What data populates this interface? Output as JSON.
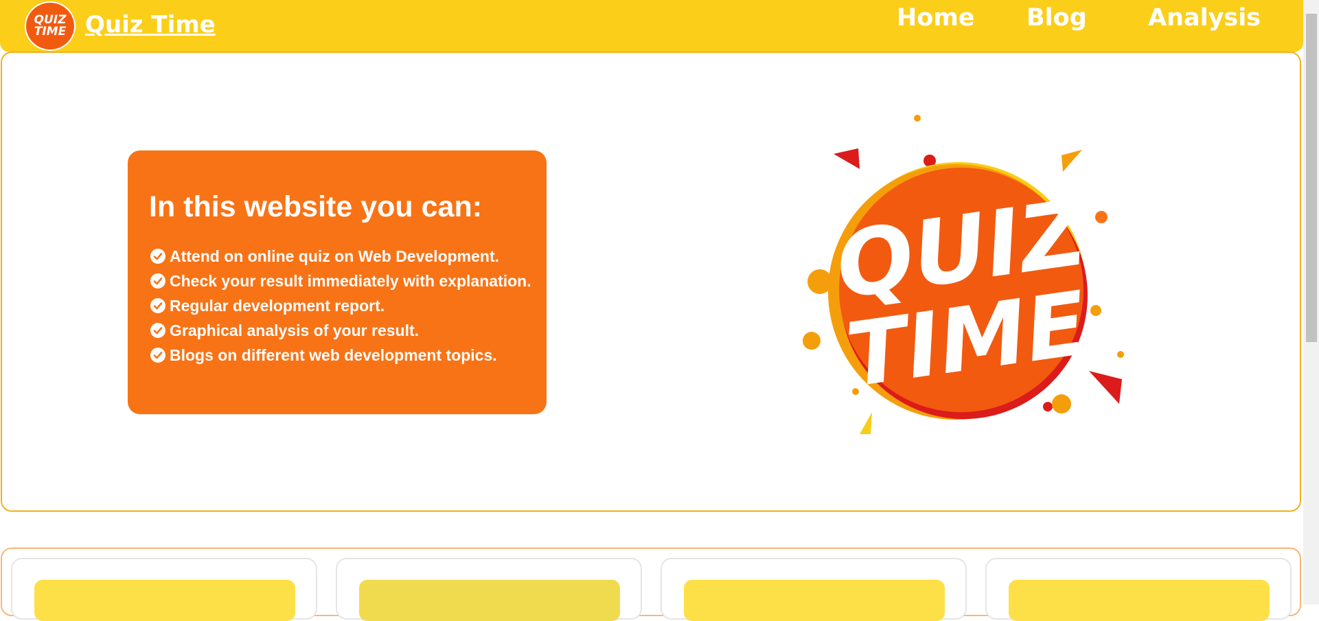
{
  "brand": {
    "logo_text_line1": "QUIZ",
    "logo_text_line2": "TIME",
    "name": "Quiz Time"
  },
  "nav": {
    "items": [
      {
        "label": "Home"
      },
      {
        "label": "Blog"
      },
      {
        "label": "Analysis"
      }
    ]
  },
  "hero": {
    "title": "In this website you can:",
    "features": [
      "Attend on online quiz on Web Development.",
      "Check your result immediately with explanation.",
      "Regular development report.",
      "Graphical analysis of your result.",
      "Blogs on different web development topics."
    ],
    "logo_line1": "QUIZ",
    "logo_line2": "TIME"
  },
  "colors": {
    "nav_bg": "#fbce1a",
    "card_bg": "#f87316",
    "border": "#f0b21b",
    "logo_orange": "#f25a10"
  },
  "icons": {
    "check": "check-circle-icon"
  }
}
